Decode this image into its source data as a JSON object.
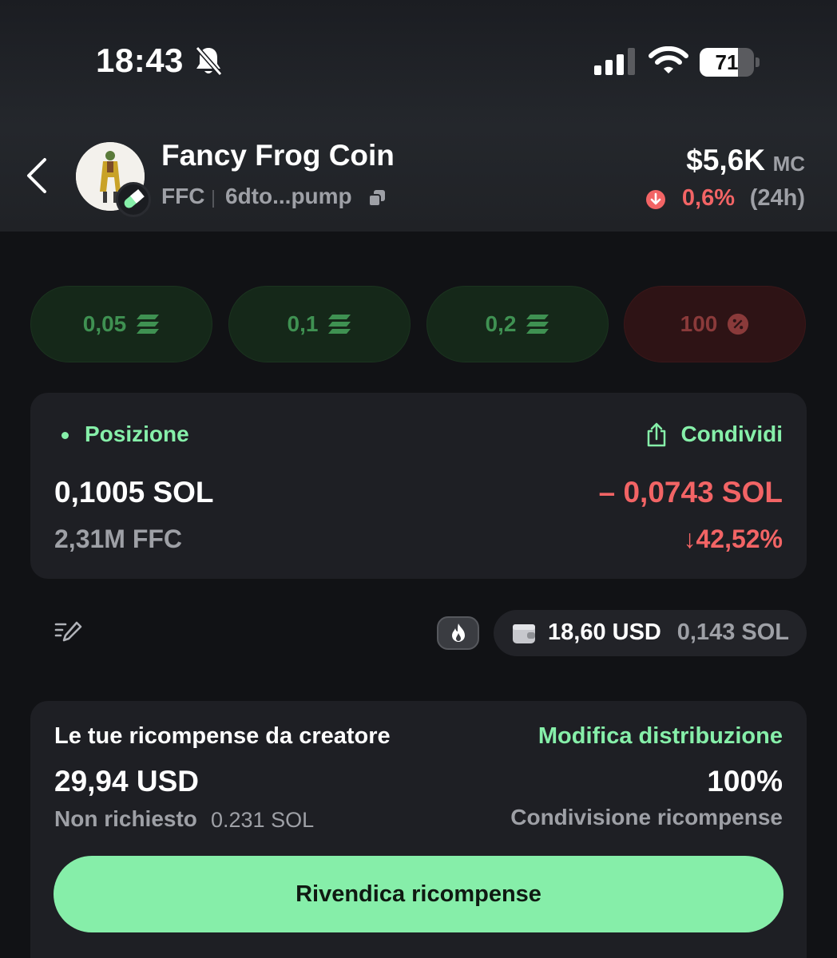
{
  "status_bar": {
    "time": "18:43",
    "battery": "71",
    "battery_level": 0.71
  },
  "header": {
    "token_name": "Fancy Frog Coin",
    "ticker": "FFC",
    "address": "6dto...pump",
    "market_cap": "$5,6K",
    "market_cap_label": "MC",
    "change": "0,6%",
    "change_period": "(24h)",
    "change_color": "#f26465"
  },
  "quick_buttons": [
    {
      "label": "0,05",
      "icon": "solana-icon"
    },
    {
      "label": "0,1",
      "icon": "solana-icon"
    },
    {
      "label": "0,2",
      "icon": "solana-icon"
    },
    {
      "label": "100",
      "icon": "percent-icon"
    }
  ],
  "position": {
    "label": "Posizione",
    "share_label": "Condividi",
    "sol_amount": "0,1005 SOL",
    "token_amount": "2,31M FFC",
    "pnl_sol": "– 0,0743 SOL",
    "pnl_pct": "↓42,52%"
  },
  "wallet": {
    "usd": "18,60 USD",
    "sol": "0,143 SOL"
  },
  "rewards": {
    "title": "Le tue ricompense da creatore",
    "edit_label": "Modifica distribuzione",
    "usd": "29,94 USD",
    "percent": "100%",
    "unclaimed_label": "Non richiesto",
    "unclaimed_value": "0.231 SOL",
    "share_label": "Condivisione ricompense",
    "claim_label": "Rivendica ricompense"
  },
  "colors": {
    "accent_green": "#86efa9",
    "negative_red": "#f26465",
    "background": "#111215",
    "card": "#1e1f24"
  }
}
